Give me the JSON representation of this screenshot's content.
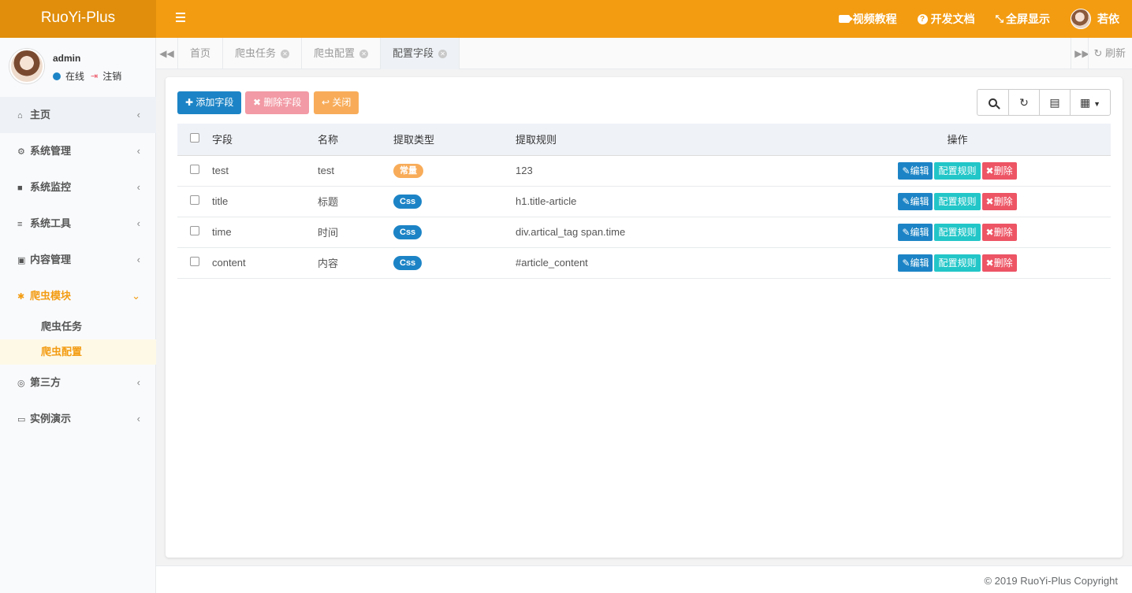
{
  "app": {
    "brand": "RuoYi-Plus"
  },
  "topbar": {
    "items": [
      {
        "label": "视频教程",
        "icon": "video-icon"
      },
      {
        "label": "开发文档",
        "icon": "question-circle-icon"
      },
      {
        "label": "全屏显示",
        "icon": "expand-icon"
      }
    ],
    "user": "若依"
  },
  "sidebar": {
    "user": {
      "name": "admin",
      "status": "在线",
      "logout": "注销"
    },
    "menu": [
      {
        "label": "主页",
        "icon": "home-icon"
      },
      {
        "label": "系统管理",
        "icon": "gear-icon"
      },
      {
        "label": "系统监控",
        "icon": "video-camera-icon"
      },
      {
        "label": "系统工具",
        "icon": "bars-icon"
      },
      {
        "label": "内容管理",
        "icon": "id-card-icon"
      },
      {
        "label": "爬虫模块",
        "icon": "bug-icon",
        "children": [
          "爬虫任务",
          "爬虫配置"
        ]
      },
      {
        "label": "第三方",
        "icon": "life-ring-icon"
      },
      {
        "label": "实例演示",
        "icon": "desktop-icon"
      }
    ]
  },
  "tabs": {
    "items": [
      "首页",
      "爬虫任务",
      "爬虫配置",
      "配置字段"
    ],
    "active": "配置字段",
    "refresh": "刷新"
  },
  "toolbar": {
    "add": "添加字段",
    "delete": "删除字段",
    "close": "关闭"
  },
  "table": {
    "headers": [
      "字段",
      "名称",
      "提取类型",
      "提取规则",
      "操作"
    ],
    "rows": [
      {
        "field": "test",
        "name": "test",
        "type": "常量",
        "type_color": "#f8ac59",
        "rule": "123"
      },
      {
        "field": "title",
        "name": "标题",
        "type": "Css",
        "type_color": "#1c84c6",
        "rule": "h1.title-article"
      },
      {
        "field": "time",
        "name": "时间",
        "type": "Css",
        "type_color": "#1c84c6",
        "rule": "div.artical_tag span.time"
      },
      {
        "field": "content",
        "name": "内容",
        "type": "Css",
        "type_color": "#1c84c6",
        "rule": "#article_content"
      }
    ],
    "actions": {
      "edit": "编辑",
      "rule": "配置规则",
      "delete": "删除"
    }
  },
  "footer": {
    "copyright": "© 2019 RuoYi-Plus Copyright"
  },
  "colors": {
    "brand": "#f39c12",
    "brand_dark": "#e08e0b",
    "primary": "#1c84c6",
    "info": "#23c6c8",
    "danger": "#ed5565",
    "warning": "#f8ac59"
  }
}
